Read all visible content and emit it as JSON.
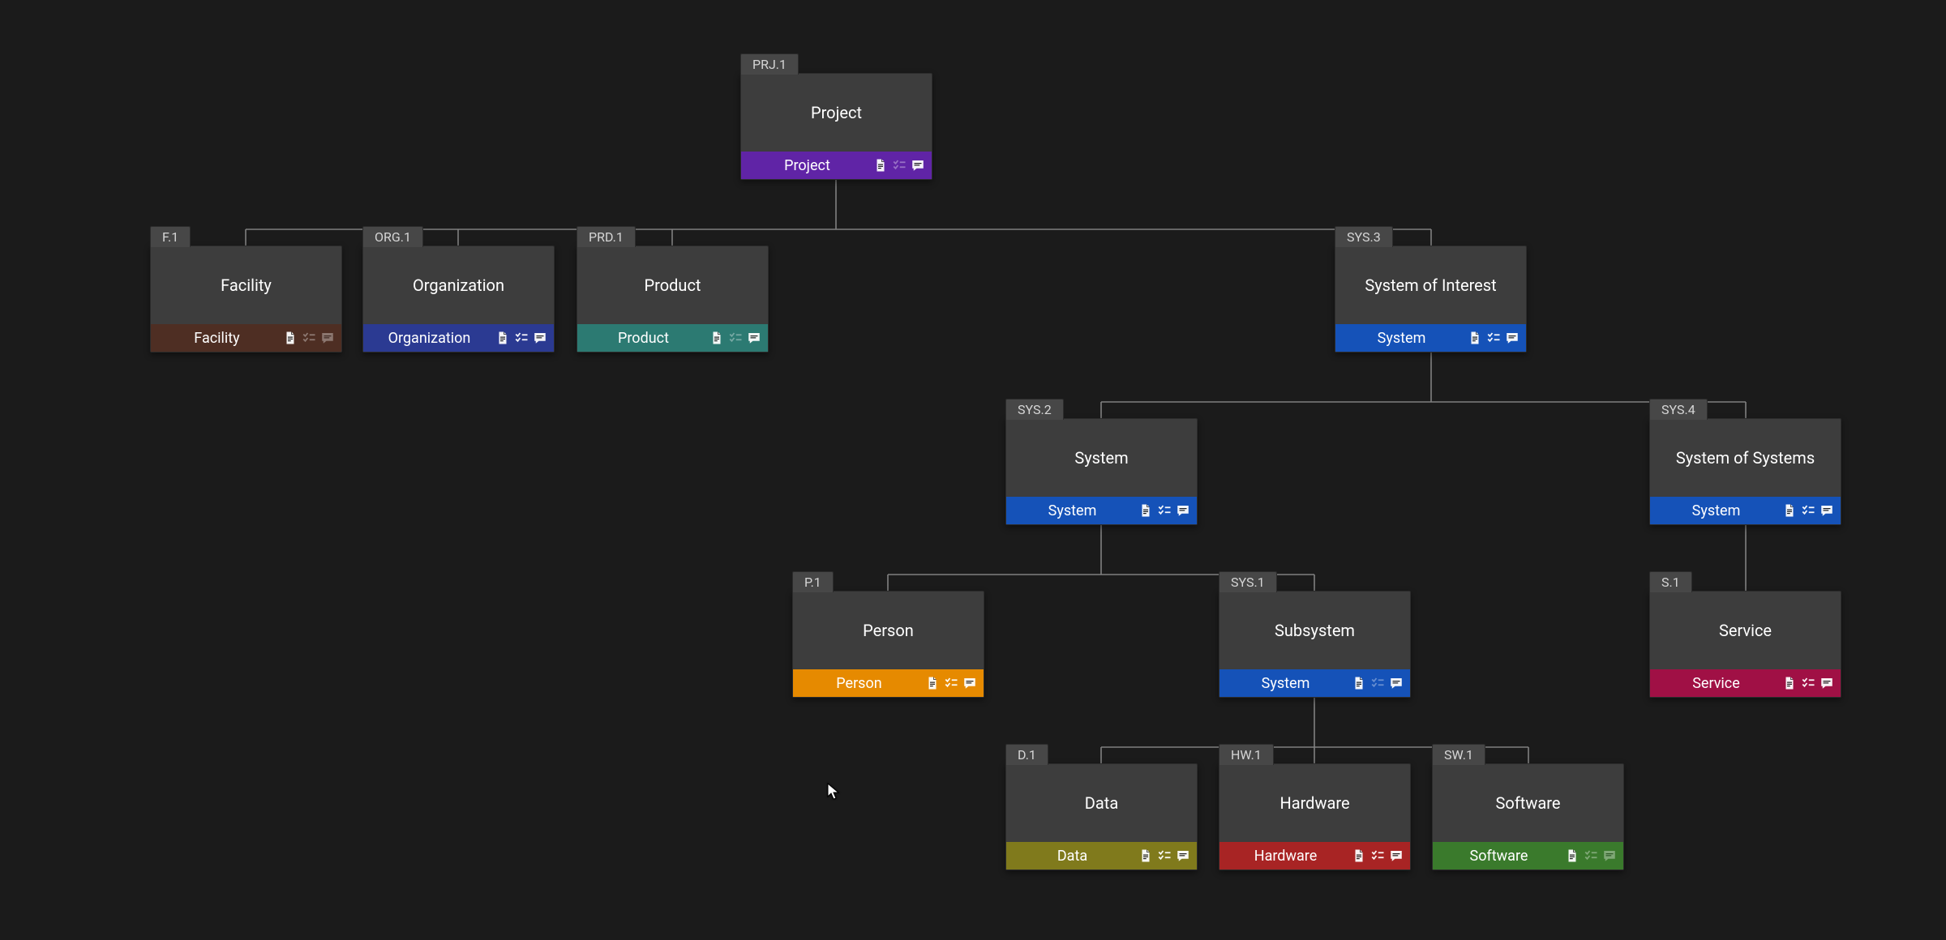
{
  "nodes": {
    "prj1": {
      "id": "PRJ.1",
      "title": "Project",
      "type": "Project",
      "color": "--purple",
      "icons": [
        "doc:full",
        "check:dim",
        "notes:full"
      ]
    },
    "f1": {
      "id": "F.1",
      "title": "Facility",
      "type": "Facility",
      "color": "--brown",
      "icons": [
        "doc:full",
        "check:dim",
        "notes:dim"
      ]
    },
    "org1": {
      "id": "ORG.1",
      "title": "Organization",
      "type": "Organization",
      "color": "--indigo",
      "icons": [
        "doc:full",
        "check:full",
        "notes:full"
      ]
    },
    "prd1": {
      "id": "PRD.1",
      "title": "Product",
      "type": "Product",
      "color": "--teal",
      "icons": [
        "doc:full",
        "check:dim",
        "notes:full"
      ]
    },
    "sys3": {
      "id": "SYS.3",
      "title": "System of Interest",
      "type": "System",
      "color": "--blue",
      "icons": [
        "doc:full",
        "check:full",
        "notes:full"
      ]
    },
    "sys2": {
      "id": "SYS.2",
      "title": "System",
      "type": "System",
      "color": "--blue",
      "icons": [
        "doc:full",
        "check:full",
        "notes:full"
      ]
    },
    "sys4": {
      "id": "SYS.4",
      "title": "System of Systems",
      "type": "System",
      "color": "--blue",
      "icons": [
        "doc:full",
        "check:full",
        "notes:full"
      ]
    },
    "p1": {
      "id": "P.1",
      "title": "Person",
      "type": "Person",
      "color": "--orange",
      "icons": [
        "doc:full",
        "check:full",
        "notes:full"
      ]
    },
    "sys1": {
      "id": "SYS.1",
      "title": "Subsystem",
      "type": "System",
      "color": "--blue",
      "icons": [
        "doc:full",
        "check:dim",
        "notes:full"
      ]
    },
    "s1": {
      "id": "S.1",
      "title": "Service",
      "type": "Service",
      "color": "--crimson",
      "icons": [
        "doc:full",
        "check:full",
        "notes:full"
      ]
    },
    "d1": {
      "id": "D.1",
      "title": "Data",
      "type": "Data",
      "color": "--olive",
      "icons": [
        "doc:full",
        "check:full",
        "notes:full"
      ]
    },
    "hw1": {
      "id": "HW.1",
      "title": "Hardware",
      "type": "Hardware",
      "color": "--red",
      "icons": [
        "doc:full",
        "check:full",
        "notes:full"
      ]
    },
    "sw1": {
      "id": "SW.1",
      "title": "Software",
      "type": "Software",
      "color": "--green",
      "icons": [
        "doc:full",
        "check:dim",
        "notes:dim"
      ]
    }
  },
  "icon_labels": {
    "doc": "document-icon",
    "check": "checklist-icon",
    "notes": "notes-icon"
  }
}
